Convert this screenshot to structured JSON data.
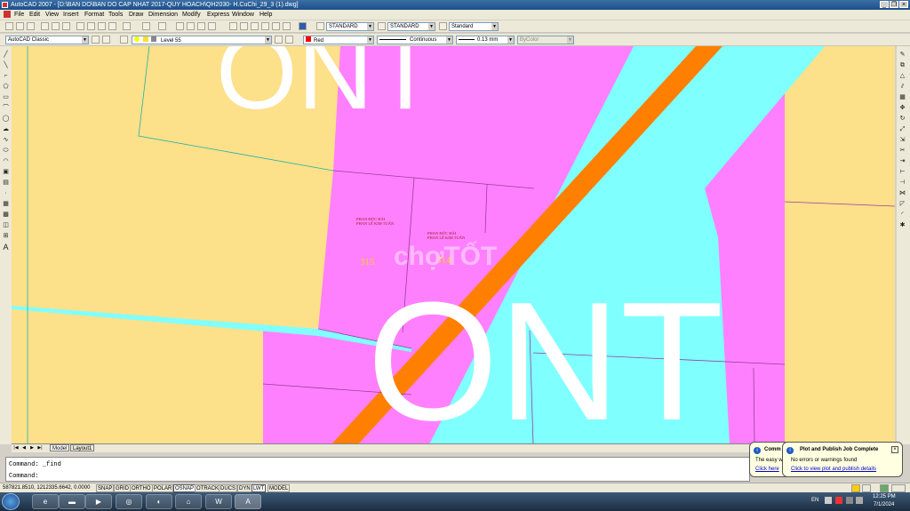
{
  "window": {
    "title": "AutoCAD 2007 - [D:\\BAN DO\\BAN DO CAP NHAT 2017-QUY HOACH\\QH2030- H.CuChi_29_3 (1).dwg]"
  },
  "menu": [
    "File",
    "Edit",
    "View",
    "Insert",
    "Format",
    "Tools",
    "Draw",
    "Dimension",
    "Modify",
    "Express",
    "Window",
    "Help"
  ],
  "toolbar": {
    "text_style": "STANDARD",
    "dim_style": "STANDARD",
    "table_style": "Standard",
    "workspace": "AutoCAD Classic",
    "layer": "Level 55",
    "color": "Red",
    "linetype": "Continuous",
    "lineweight": "0.13 mm",
    "plotstyle": "ByColor"
  },
  "drawing": {
    "big_labels": [
      "ONT",
      "ONT"
    ],
    "parcels": [
      {
        "number": "315",
        "owner_line1": "PHAN ĐỨC HẢI",
        "owner_line2": "PHAN LÊ KIM TUẤN"
      },
      {
        "number": "314",
        "owner_line1": "PHAN ĐỨC HẢI",
        "owner_line2": "PHAN LÊ KIM TUẤN"
      }
    ],
    "watermark": "chợTỐT"
  },
  "tabs": {
    "model": "Model",
    "layout": "Layout1"
  },
  "command": {
    "line1": "Command: _find",
    "line2": "Command:"
  },
  "status": {
    "coords": "587821.8510, 1212335.6642, 0.0000",
    "toggles": [
      "SNAP",
      "GRID",
      "ORTHO",
      "POLAR",
      "OSNAP",
      "OTRACK",
      "DUCS",
      "DYN",
      "LWT",
      "MODEL"
    ]
  },
  "balloon_back": {
    "title": "Comm",
    "line1": "The easy w",
    "link": "Click here"
  },
  "balloon": {
    "title": "Plot and Publish Job Complete",
    "message": "No errors or warnings found",
    "link": "Click to view plot and publish details"
  },
  "tray": {
    "lang": "EN",
    "time": "12:25 PM",
    "date": "7/1/2024"
  },
  "colors": {
    "residential": "#ff80ff",
    "road": "#ff7f00",
    "water": "#80ffff",
    "agri": "#fce08a"
  }
}
